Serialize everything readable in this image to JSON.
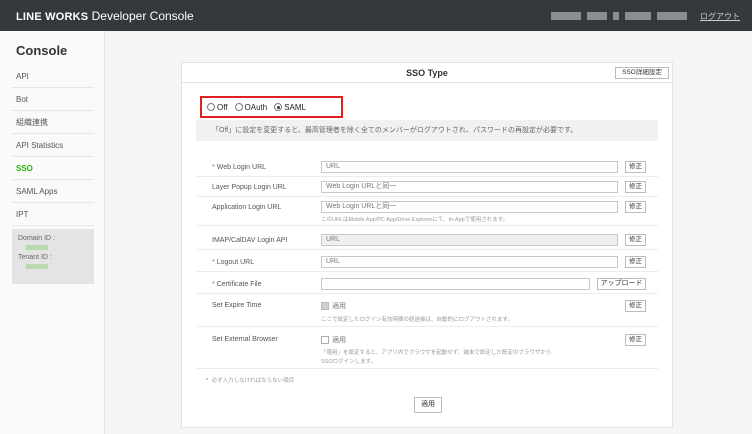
{
  "header": {
    "brand_bold": "LINE WORKS",
    "brand_rest": " Developer Console",
    "logout": "ログアウト"
  },
  "sidebar": {
    "title": "Console",
    "items": [
      {
        "label": "API"
      },
      {
        "label": "Bot"
      },
      {
        "label": "組織連携"
      },
      {
        "label": "API Statistics"
      },
      {
        "label": "SSO",
        "active": true
      },
      {
        "label": "SAML Apps"
      },
      {
        "label": "IPT"
      }
    ],
    "domain_label": "Domain ID :",
    "tenant_label": "Tenant ID :"
  },
  "panel": {
    "title": "SSO Type",
    "header_button": "SSO詳細設定",
    "radios": [
      {
        "label": "Off",
        "checked": false
      },
      {
        "label": "OAuth",
        "checked": false
      },
      {
        "label": "SAML",
        "checked": true
      }
    ],
    "notice": "「Off」に設定を変更すると、最高管理者を除く全てのメンバーがログアウトされ、パスワードの再設定が必要です。",
    "rows": {
      "web_login": {
        "label": "Web Login URL",
        "value": "URL",
        "button": "修正"
      },
      "layer_popup": {
        "label": "Layer Popup Login URL",
        "value": "Web Login URLと同一",
        "button": "修正"
      },
      "app_login": {
        "label": "Application Login URL",
        "value": "Web Login URLと同一",
        "button": "修正",
        "hint": "このURLはMobile App/PC App/Drive Explorerにて、In-Appで使用されます。"
      },
      "imap": {
        "label": "IMAP/CalDAV Login API",
        "value": "URL",
        "button": "修正"
      },
      "logout": {
        "label": "Logout URL",
        "value": "URL",
        "button": "修正"
      },
      "cert": {
        "label": "Certificate File",
        "value": "",
        "button": "アップロード"
      },
      "expire": {
        "label": "Set Expire Time",
        "check_label": "適用",
        "button": "修正",
        "hint": "ここで設定したログイン有効時間の経過後は、自動的にログアウトされます。"
      },
      "ext_browser": {
        "label": "Set External Browser",
        "check_label": "適用",
        "button": "修正",
        "hint1": "「適用」を設定すると、アプリ内でブラウザを起動せず、端末で設定した既定のブラウザから",
        "hint2": "SSOログインします。"
      }
    },
    "required_note": "必ず入力しなければならない項目",
    "apply": "適用"
  }
}
